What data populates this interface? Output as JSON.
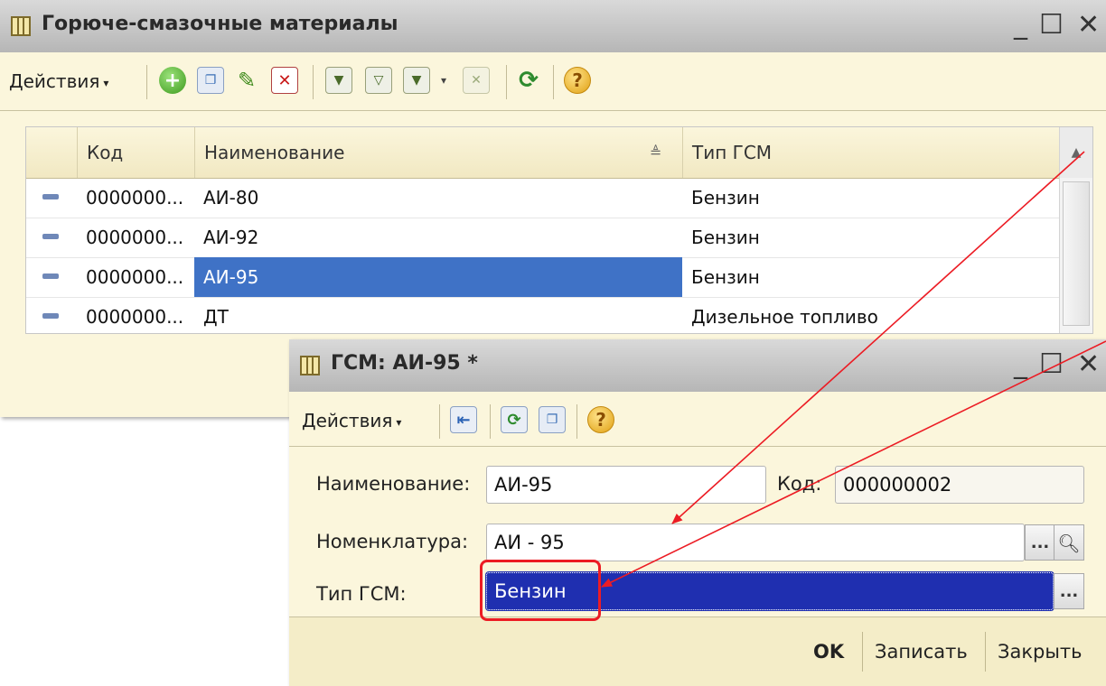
{
  "list_window": {
    "title": "Горюче-смазочные материалы",
    "minimize": "_",
    "maximize": "☐",
    "close": "✕",
    "toolbar": {
      "actions_label": "Действия",
      "actions_arrow": "▾"
    },
    "columns": [
      "Код",
      "Наименование",
      "Тип ГСМ"
    ],
    "rows": [
      {
        "code": "0000000...",
        "name": "АИ-80",
        "type": "Бензин",
        "selected": false
      },
      {
        "code": "0000000...",
        "name": "АИ-92",
        "type": "Бензин",
        "selected": false
      },
      {
        "code": "0000000...",
        "name": "АИ-95",
        "type": "Бензин",
        "selected": true
      },
      {
        "code": "0000000...",
        "name": "ДТ",
        "type": "Дизельное топливо",
        "selected": false
      }
    ]
  },
  "dialog": {
    "title": "ГСМ: АИ-95 *",
    "minimize": "_",
    "maximize": "☐",
    "close": "✕",
    "toolbar": {
      "actions_label": "Действия",
      "actions_arrow": "▾"
    },
    "fields": {
      "name_label": "Наименование:",
      "name_value": "АИ-95",
      "code_label": "Код:",
      "code_value": "000000002",
      "nomenclature_label": "Номенклатура:",
      "nomenclature_value": "АИ - 95",
      "fuel_type_label": "Тип ГСМ:",
      "fuel_type_value": "Бензин"
    },
    "buttons": {
      "ok": "OK",
      "save": "Записать",
      "close": "Закрыть"
    }
  },
  "colors": {
    "selection": "#3f72c6",
    "highlight_field": "#1f2fb0",
    "annotation": "#ec1c24"
  }
}
